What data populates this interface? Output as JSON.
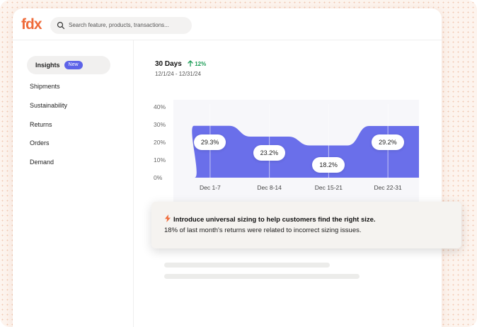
{
  "app": {
    "logo": "fdx"
  },
  "search": {
    "placeholder": "Search feature, products, transactions..."
  },
  "sidebar": {
    "items": [
      {
        "label": "Insights",
        "badge": "New",
        "active": true
      },
      {
        "label": "Shipments"
      },
      {
        "label": "Sustainability"
      },
      {
        "label": "Returns"
      },
      {
        "label": "Orders"
      },
      {
        "label": "Demand"
      }
    ]
  },
  "summary": {
    "period": "30 Days",
    "trend": "12%",
    "date_range": "12/1/24 - 12/31/24"
  },
  "chart_data": {
    "type": "area",
    "y_ticks": [
      "40%",
      "30%",
      "20%",
      "10%",
      "0%"
    ],
    "ylim": [
      0,
      40
    ],
    "categories": [
      "Dec 1-7",
      "Dec 8-14",
      "Dec 15-21",
      "Dec 22-31"
    ],
    "values": [
      29.3,
      23.2,
      18.2,
      29.2
    ],
    "value_labels": [
      "29.3%",
      "23.2%",
      "18.2%",
      "29.2%"
    ],
    "color": "#5d63e8"
  },
  "insight": {
    "title": "Introduce universal sizing to help customers find the right size.",
    "body": "18% of last month's returns were related to incorrect sizing issues.",
    "icon": "lightning-icon"
  },
  "colors": {
    "accent": "#ef6b3a",
    "brand": "#5d63e8",
    "positive": "#1d9d57"
  }
}
